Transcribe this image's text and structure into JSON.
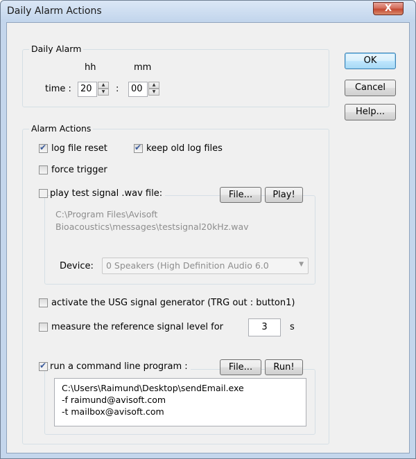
{
  "window": {
    "title": "Daily Alarm Actions",
    "close_glyph": "X"
  },
  "buttons": {
    "ok": "OK",
    "cancel": "Cancel",
    "help": "Help..."
  },
  "daily_alarm": {
    "group_label": "Daily Alarm",
    "hh_label": "hh",
    "mm_label": "mm",
    "time_label": "time :",
    "colon": ":",
    "hours": "20",
    "minutes": "00"
  },
  "alarm_actions": {
    "group_label": "Alarm Actions",
    "log_file_reset": {
      "label": "log file reset",
      "checked": true
    },
    "keep_old_log_files": {
      "label": "keep old log files",
      "checked": true
    },
    "force_trigger": {
      "label": "force trigger",
      "checked": false
    },
    "play_test_signal": {
      "label": "play test signal .wav file:",
      "checked": false,
      "file_button": "File...",
      "play_button": "Play!",
      "path_line1": "C:\\Program Files\\Avisoft",
      "path_line2": "Bioacoustics\\messages\\testsignal20kHz.wav",
      "device_label": "Device:",
      "device_value": "0 Speakers (High Definition Audio 6.0"
    },
    "activate_usg": {
      "label": "activate the USG signal generator (TRG out : button1)",
      "checked": false
    },
    "measure_reference": {
      "label": "measure the reference signal level for",
      "checked": false,
      "value": "3",
      "unit": "s"
    },
    "run_command": {
      "label": "run a command line program :",
      "checked": true,
      "file_button": "File...",
      "run_button": "Run!",
      "line1": "C:\\Users\\Raimund\\Desktop\\sendEmail.exe",
      "line2": "-f raimund@avisoft.com",
      "line3": "-t mailbox@avisoft.com"
    }
  }
}
